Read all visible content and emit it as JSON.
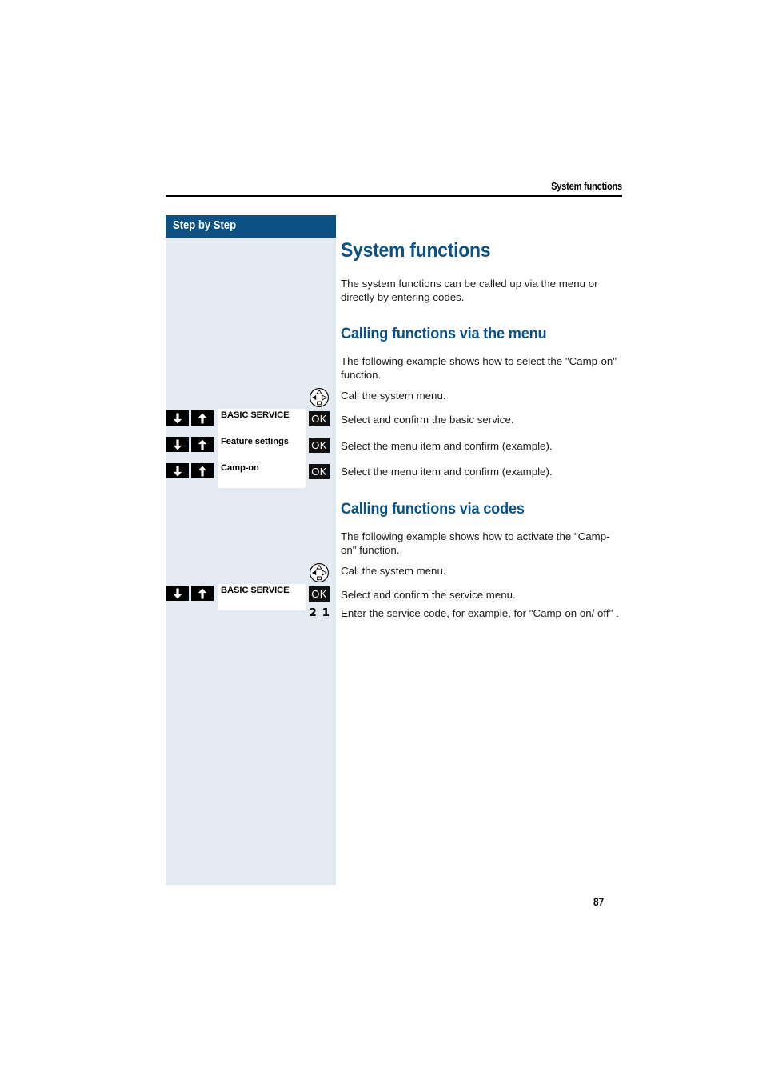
{
  "header": {
    "running_title": "System functions"
  },
  "sidebar": {
    "title": "Step by Step"
  },
  "page": {
    "number": "87"
  },
  "main": {
    "title": "System functions",
    "intro": "The system functions can be called up via the menu or directly by entering codes.",
    "sections": [
      {
        "heading": "Calling functions via the menu",
        "intro": "The following example shows how to select the \"Camp-on\" function.",
        "steps": [
          {
            "icon": "navigation-wheel-icon",
            "description": "Call the system menu."
          },
          {
            "icon": "updown-arrows-icon",
            "display": "BASIC SERVICE",
            "key": "OK",
            "description": "Select and confirm the basic service."
          },
          {
            "icon": "updown-arrows-icon",
            "display": "Feature settings",
            "key": "OK",
            "description": "Select the menu item and confirm (example)."
          },
          {
            "icon": "updown-arrows-icon",
            "display": "Camp-on",
            "key": "OK",
            "description": "Select the menu item and confirm (example)."
          }
        ]
      },
      {
        "heading": "Calling functions via codes",
        "intro": "The following example shows how to activate the \"Camp-on\" function.",
        "steps": [
          {
            "icon": "navigation-wheel-icon",
            "description": "Call the system menu."
          },
          {
            "icon": "updown-arrows-icon",
            "display": "BASIC SERVICE",
            "key": "OK",
            "description": "Select and confirm the service menu."
          },
          {
            "icon": "keypad-code-icon",
            "code": "2 1",
            "description": "Enter the service code, for example, for \"Camp-on on/ off\" ."
          }
        ]
      }
    ]
  },
  "colors": {
    "accent_blue": "#0b5184",
    "panel_bg": "#e3eaf2",
    "key_black": "#111111"
  }
}
